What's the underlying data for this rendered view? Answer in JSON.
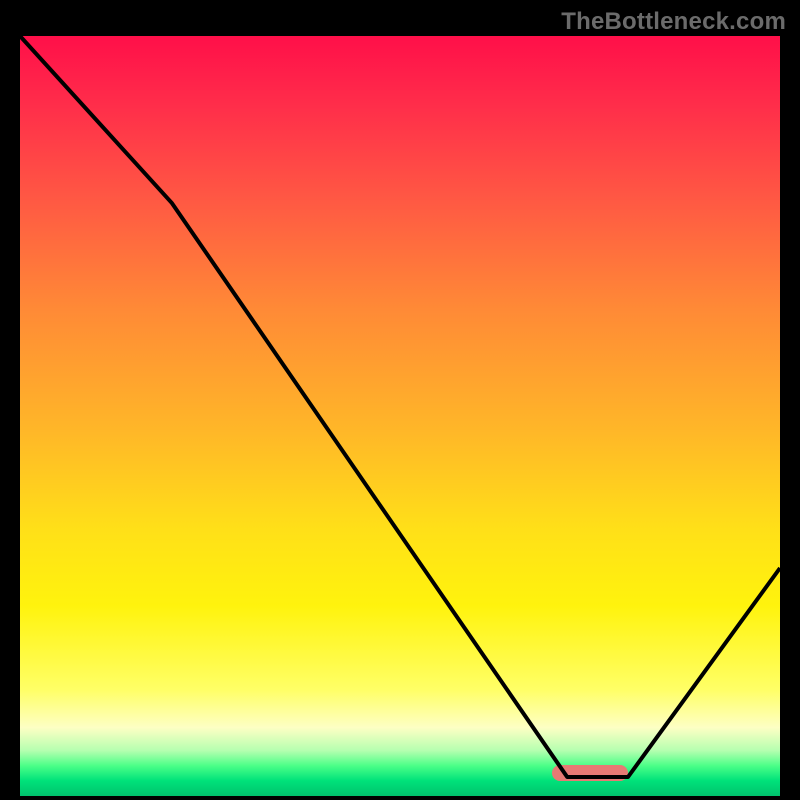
{
  "watermark": "TheBottleneck.com",
  "chart_data": {
    "type": "line",
    "title": "",
    "xlabel": "",
    "ylabel": "",
    "xlim": [
      0,
      100
    ],
    "ylim": [
      0,
      100
    ],
    "grid": false,
    "legend": false,
    "series": [
      {
        "name": "bottleneck-curve",
        "x": [
          0,
          20,
          72,
          80,
          100
        ],
        "y": [
          100,
          78,
          2.5,
          2.5,
          30
        ]
      }
    ],
    "marker": {
      "name": "optimal-range",
      "x_start": 70,
      "x_end": 80,
      "y": 3,
      "color": "#e77a74"
    },
    "background_gradient": {
      "direction": "vertical",
      "stops": [
        {
          "pos": 0,
          "color": "#ff0f49"
        },
        {
          "pos": 9,
          "color": "#ff2d4a"
        },
        {
          "pos": 22,
          "color": "#ff5a43"
        },
        {
          "pos": 36,
          "color": "#ff8a36"
        },
        {
          "pos": 52,
          "color": "#ffb728"
        },
        {
          "pos": 65,
          "color": "#ffe018"
        },
        {
          "pos": 75,
          "color": "#fff30d"
        },
        {
          "pos": 86,
          "color": "#ffff66"
        },
        {
          "pos": 91,
          "color": "#fdffc4"
        },
        {
          "pos": 94,
          "color": "#b6ffb0"
        },
        {
          "pos": 96,
          "color": "#4cff88"
        },
        {
          "pos": 98,
          "color": "#00e27a"
        },
        {
          "pos": 100,
          "color": "#00c26d"
        }
      ]
    }
  }
}
